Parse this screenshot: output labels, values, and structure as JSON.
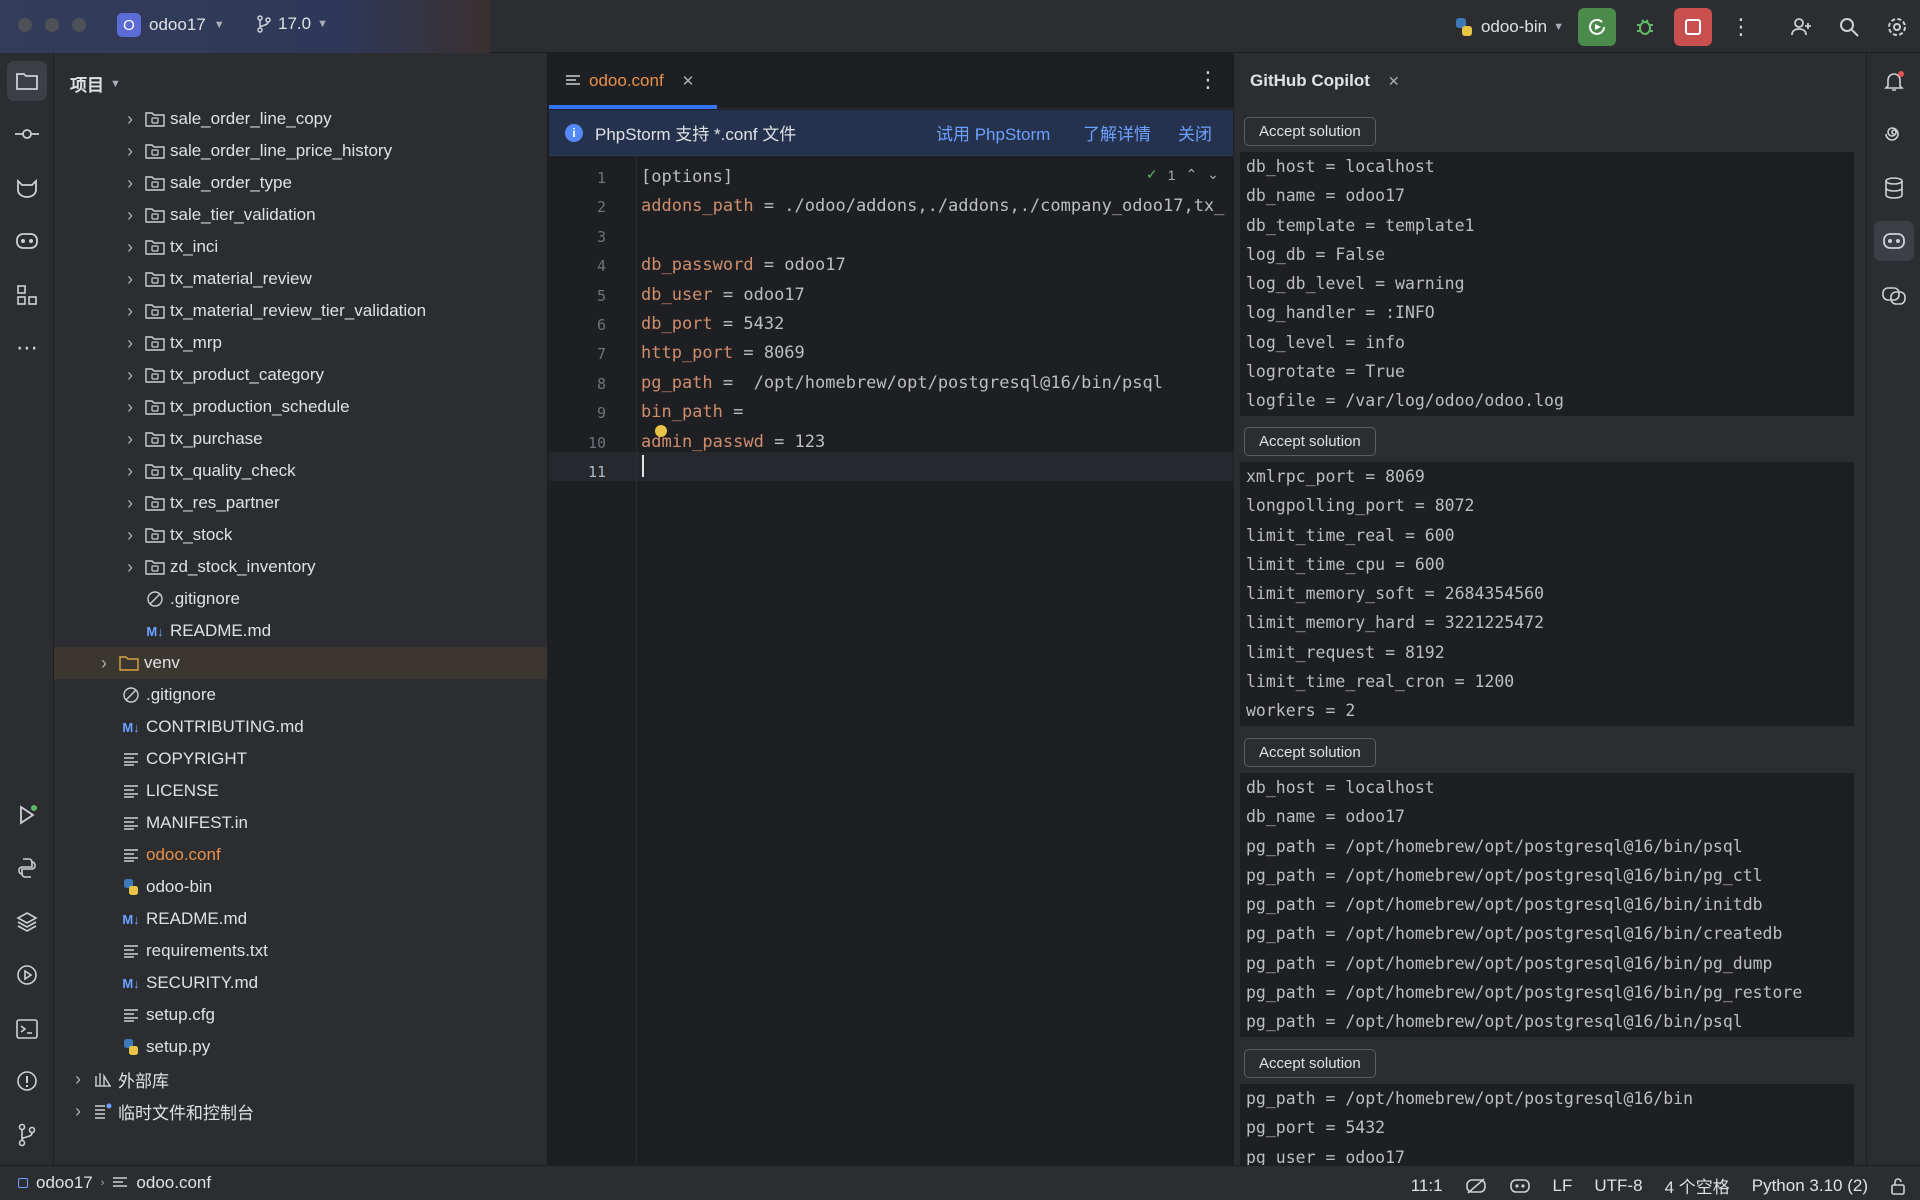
{
  "titlebar": {
    "project_badge": "O",
    "project_name": "odoo17",
    "branch": "17.0",
    "run_config": "odoo-bin"
  },
  "project_panel": {
    "title": "项目",
    "items": [
      {
        "label": "sale_order_line_copy",
        "type": "module"
      },
      {
        "label": "sale_order_line_price_history",
        "type": "module"
      },
      {
        "label": "sale_order_type",
        "type": "module"
      },
      {
        "label": "sale_tier_validation",
        "type": "module"
      },
      {
        "label": "tx_inci",
        "type": "module"
      },
      {
        "label": "tx_material_review",
        "type": "module"
      },
      {
        "label": "tx_material_review_tier_validation",
        "type": "module"
      },
      {
        "label": "tx_mrp",
        "type": "module"
      },
      {
        "label": "tx_product_category",
        "type": "module"
      },
      {
        "label": "tx_production_schedule",
        "type": "module"
      },
      {
        "label": "tx_purchase",
        "type": "module"
      },
      {
        "label": "tx_quality_check",
        "type": "module"
      },
      {
        "label": "tx_res_partner",
        "type": "module"
      },
      {
        "label": "tx_stock",
        "type": "module"
      },
      {
        "label": "zd_stock_inventory",
        "type": "module"
      },
      {
        "label": ".gitignore",
        "type": "ignore"
      },
      {
        "label": "README.md",
        "type": "md"
      },
      {
        "label": "venv",
        "type": "folder"
      },
      {
        "label": ".gitignore",
        "type": "ignore"
      },
      {
        "label": "CONTRIBUTING.md",
        "type": "md"
      },
      {
        "label": "COPYRIGHT",
        "type": "text"
      },
      {
        "label": "LICENSE",
        "type": "text"
      },
      {
        "label": "MANIFEST.in",
        "type": "text"
      },
      {
        "label": "odoo.conf",
        "type": "text"
      },
      {
        "label": "odoo-bin",
        "type": "python"
      },
      {
        "label": "README.md",
        "type": "md"
      },
      {
        "label": "requirements.txt",
        "type": "text"
      },
      {
        "label": "SECURITY.md",
        "type": "md"
      },
      {
        "label": "setup.cfg",
        "type": "text"
      },
      {
        "label": "setup.py",
        "type": "python"
      },
      {
        "label": "外部库",
        "type": "lib"
      },
      {
        "label": "临时文件和控制台",
        "type": "scratch"
      }
    ]
  },
  "editor": {
    "tab_label": "odoo.conf",
    "banner": {
      "text": "PhpStorm 支持 *.conf 文件",
      "try": "试用 PhpStorm",
      "learn": "了解详情",
      "close": "关闭"
    },
    "inspection_count": "1",
    "lines": [
      {
        "n": "1",
        "key": "",
        "rest": "[options]"
      },
      {
        "n": "2",
        "key": "addons_path",
        "rest": " = ./odoo/addons,./addons,./company_odoo17,tx_"
      },
      {
        "n": "3",
        "key": "",
        "rest": ""
      },
      {
        "n": "4",
        "key": "db_password",
        "rest": " = odoo17"
      },
      {
        "n": "5",
        "key": "db_user",
        "rest": " = odoo17"
      },
      {
        "n": "6",
        "key": "db_port",
        "rest": " = 5432"
      },
      {
        "n": "7",
        "key": "http_port",
        "rest": " = 8069"
      },
      {
        "n": "8",
        "key": "pg_path",
        "rest": " =  /opt/homebrew/opt/postgresql@16/bin/psql"
      },
      {
        "n": "9",
        "key": "bin_path",
        "rest": " ="
      },
      {
        "n": "10",
        "key": "admin_passwd",
        "rest": " = 123"
      },
      {
        "n": "11",
        "key": "",
        "rest": ""
      }
    ]
  },
  "copilot": {
    "title": "GitHub Copilot",
    "accept_label": "Accept solution",
    "solutions": [
      [
        "db_host = localhost",
        "db_name = odoo17",
        "db_template = template1",
        "log_db = False",
        "log_db_level = warning",
        "log_handler = :INFO",
        "log_level = info",
        "logrotate = True",
        "logfile = /var/log/odoo/odoo.log"
      ],
      [
        "xmlrpc_port = 8069",
        "longpolling_port = 8072",
        "limit_time_real = 600",
        "limit_time_cpu = 600",
        "limit_memory_soft = 2684354560",
        "limit_memory_hard = 3221225472",
        "limit_request = 8192",
        "limit_time_real_cron = 1200",
        "workers = 2"
      ],
      [
        "db_host = localhost",
        "db_name = odoo17",
        "pg_path = /opt/homebrew/opt/postgresql@16/bin/psql",
        "pg_path = /opt/homebrew/opt/postgresql@16/bin/pg_ctl",
        "pg_path = /opt/homebrew/opt/postgresql@16/bin/initdb",
        "pg_path = /opt/homebrew/opt/postgresql@16/bin/createdb",
        "pg_path = /opt/homebrew/opt/postgresql@16/bin/pg_dump",
        "pg_path = /opt/homebrew/opt/postgresql@16/bin/pg_restore",
        "pg_path = /opt/homebrew/opt/postgresql@16/bin/psql"
      ],
      [
        "pg_path = /opt/homebrew/opt/postgresql@16/bin",
        "pg_port = 5432",
        "pg_user = odoo17"
      ]
    ]
  },
  "statusbar": {
    "crumb_project": "odoo17",
    "crumb_file": "odoo.conf",
    "position": "11:1",
    "line_sep": "LF",
    "encoding": "UTF-8",
    "indent": "4 个空格",
    "interpreter": "Python 3.10 (2)"
  },
  "colors": {
    "accent": "#3574f0",
    "modified_file": "#e9914a",
    "run_green": "#4a8a4a",
    "stop_red": "#c94f4f"
  }
}
